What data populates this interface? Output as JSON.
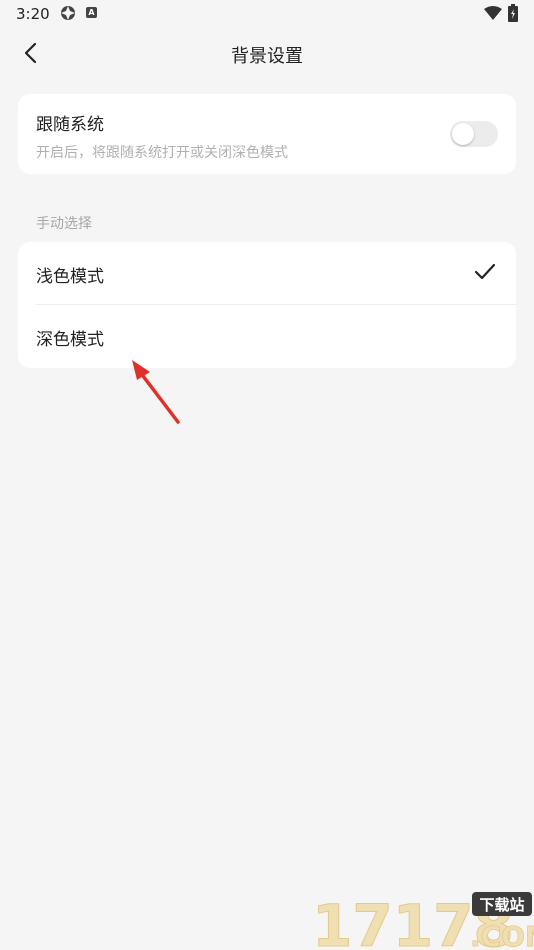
{
  "status_bar": {
    "time": "3:20",
    "icons": [
      "vpn-icon",
      "app-notification-icon",
      "wifi-icon",
      "battery-charging-icon"
    ]
  },
  "header": {
    "title": "背景设置",
    "back_icon": "chevron-left-icon"
  },
  "follow_system": {
    "title": "跟随系统",
    "description": "开启后，将跟随系统打开或关闭深色模式",
    "enabled": false
  },
  "manual": {
    "section_label": "手动选择",
    "options": [
      {
        "label": "浅色模式",
        "selected": true
      },
      {
        "label": "深色模式",
        "selected": false
      }
    ]
  },
  "watermark": {
    "text": "17178.COM",
    "sub_text": "下载站"
  },
  "colors": {
    "background": "#f5f5f5",
    "card": "#ffffff",
    "arrow": "#e0302a"
  }
}
